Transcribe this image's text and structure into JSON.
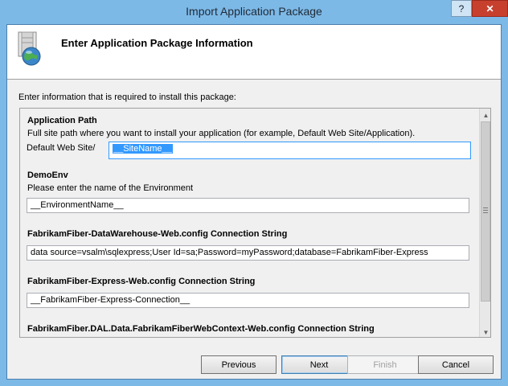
{
  "window": {
    "title": "Import Application Package",
    "help_glyph": "?",
    "close_glyph": "✕"
  },
  "header": {
    "title": "Enter Application Package Information",
    "icon": "package-globe-icon"
  },
  "intro_text": "Enter information that is required to install this package:",
  "sections": {
    "app_path": {
      "title": "Application Path",
      "description": "Full site path where you want to install your application (for example, Default Web Site/Application).",
      "prefix": "Default Web Site/",
      "value": "__SiteName__"
    },
    "demo_env": {
      "title": "DemoEnv",
      "description": "Please enter the name of the Environment",
      "value": "__EnvironmentName__"
    },
    "warehouse_conn": {
      "title": "FabrikamFiber-DataWarehouse-Web.config Connection String",
      "value": "data source=vsalm\\sqlexpress;User Id=sa;Password=myPassword;database=FabrikamFiber-Express"
    },
    "express_conn": {
      "title": "FabrikamFiber-Express-Web.config Connection String",
      "value": "__FabrikamFiber-Express-Connection__"
    },
    "dal_conn": {
      "title": "FabrikamFiber.DAL.Data.FabrikamFiberWebContext-Web.config Connection String"
    }
  },
  "buttons": {
    "previous": "Previous",
    "next": "Next",
    "finish": "Finish",
    "cancel": "Cancel"
  },
  "colors": {
    "window_frame": "#7db9e7",
    "close_button": "#c7402e",
    "selection": "#3399ff"
  }
}
